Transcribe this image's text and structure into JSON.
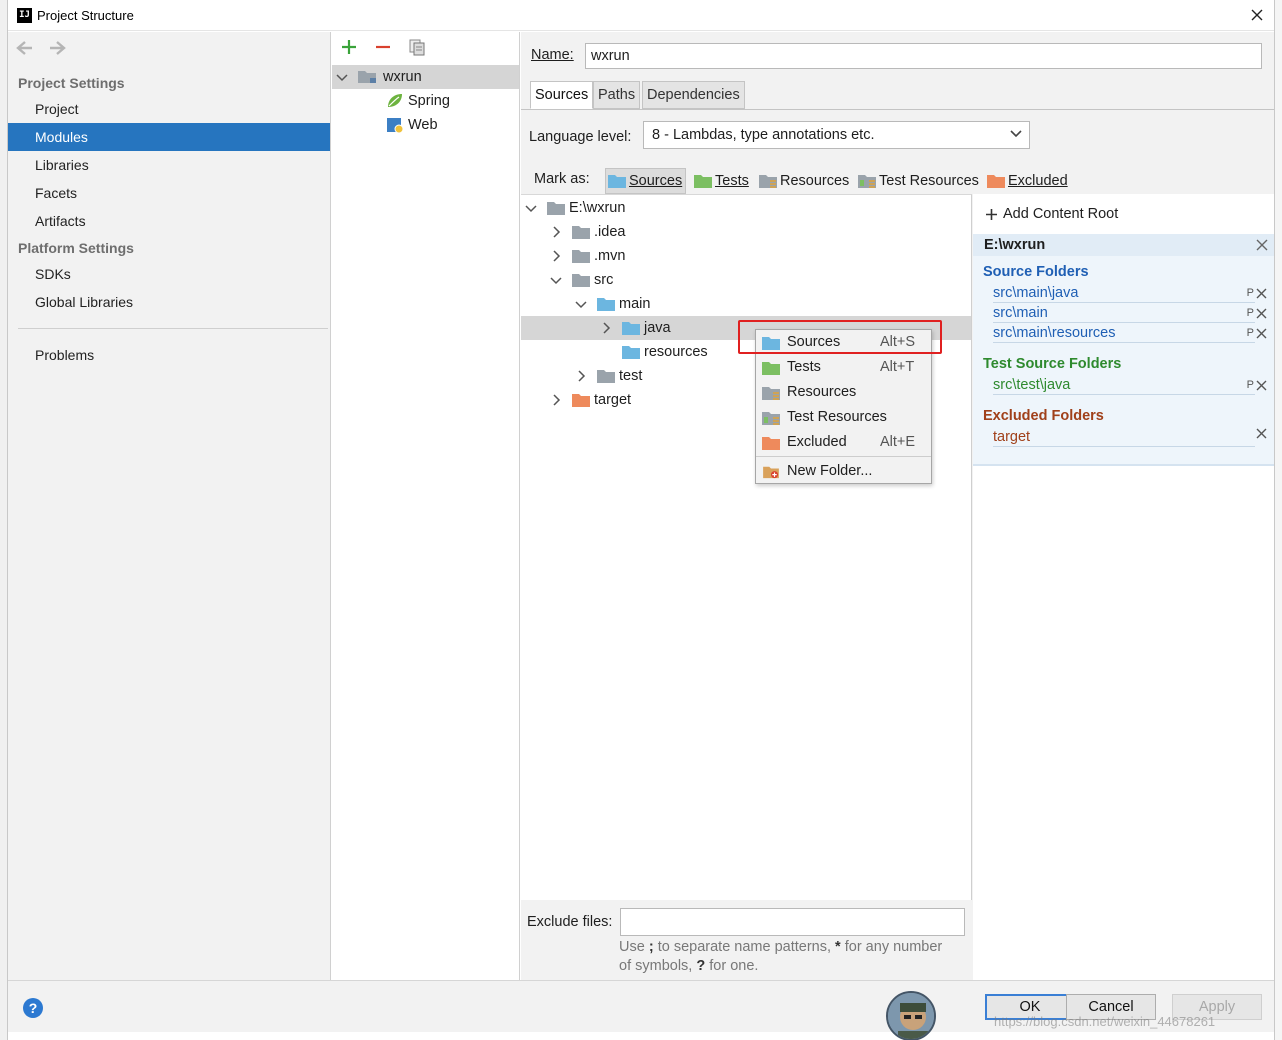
{
  "window": {
    "title": "Project Structure"
  },
  "nav": {
    "project_settings_label": "Project Settings",
    "project_items": [
      "Project",
      "Modules",
      "Libraries",
      "Facets",
      "Artifacts"
    ],
    "platform_settings_label": "Platform Settings",
    "platform_items": [
      "SDKs",
      "Global Libraries"
    ],
    "problems": "Problems",
    "selected": "Modules"
  },
  "modules": {
    "root": "wxrun",
    "children": [
      "Spring",
      "Web"
    ]
  },
  "main": {
    "name_label": "Name:",
    "name_value": "wxrun",
    "tabs": [
      "Sources",
      "Paths",
      "Dependencies"
    ],
    "active_tab": "Sources",
    "language_level_label": "Language level:",
    "language_level_value": "8 - Lambdas, type annotations etc.",
    "mark_as_label": "Mark as:",
    "mark_as": [
      "Sources",
      "Tests",
      "Resources",
      "Test Resources",
      "Excluded"
    ],
    "tree": {
      "root": "E:\\wxrun",
      "idea": ".idea",
      "mvn": ".mvn",
      "src": "src",
      "main": "main",
      "java": "java",
      "resources": "resources",
      "test": "test",
      "target": "target"
    },
    "exclude_label": "Exclude files:",
    "exclude_value": "",
    "hint_1": "Use",
    "hint_2": ";",
    "hint_3": "to separate name patterns,",
    "hint_4": "*",
    "hint_5": "for any number",
    "hint_6": "of symbols,",
    "hint_7": "?",
    "hint_8": "for one."
  },
  "roots": {
    "add_label": "Add Content Root",
    "content_root": "E:\\wxrun",
    "source_folders_label": "Source Folders",
    "source_folders": [
      "src\\main\\java",
      "src\\main",
      "src\\main\\resources"
    ],
    "test_folders_label": "Test Source Folders",
    "test_folders": [
      "src\\test\\java"
    ],
    "excluded_label": "Excluded Folders",
    "excluded_folders": [
      "target"
    ],
    "package_prefix_glyph": "P"
  },
  "popup": {
    "items": [
      {
        "label": "Sources",
        "shortcut": "Alt+S"
      },
      {
        "label": "Tests",
        "shortcut": "Alt+T"
      },
      {
        "label": "Resources",
        "shortcut": ""
      },
      {
        "label": "Test Resources",
        "shortcut": ""
      },
      {
        "label": "Excluded",
        "shortcut": "Alt+E"
      }
    ],
    "new_folder": "New Folder..."
  },
  "buttons": {
    "ok": "OK",
    "cancel": "Cancel",
    "apply": "Apply",
    "help": "?"
  },
  "watermark": "https://blog.csdn.net/weixin_44678261",
  "colors": {
    "selection": "#2675bf",
    "source_folder": "#6cb6e0",
    "test_folder": "#7cbf62",
    "excluded_folder": "#ee8a5c",
    "source_header": "#1f5fb4",
    "test_header": "#2e8a2e",
    "excluded_header": "#a0401a",
    "highlight_box": "#e02020"
  }
}
